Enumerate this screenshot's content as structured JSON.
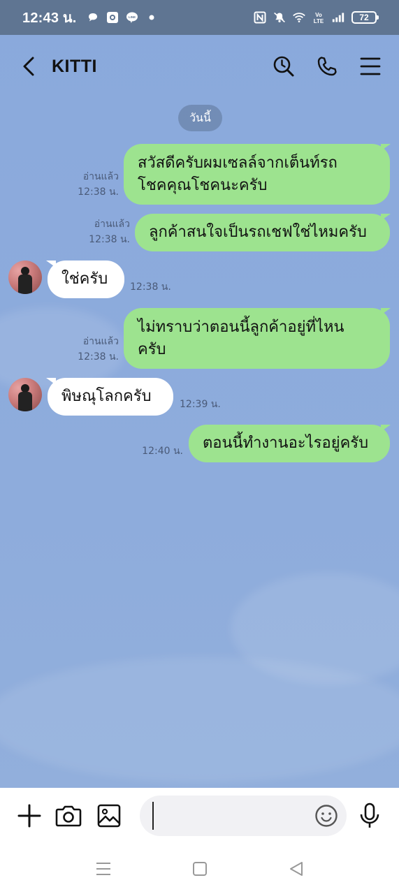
{
  "status_bar": {
    "time": "12:43 น.",
    "battery": "72",
    "left_icons": [
      "chat-bubble-icon",
      "camera-square-icon",
      "line-icon",
      "dot-icon"
    ],
    "right_icons": [
      "nfc-icon",
      "mute-icon",
      "wifi-icon",
      "volte-icon",
      "signal-icon",
      "battery-icon"
    ]
  },
  "header": {
    "title": "KITTI"
  },
  "chat": {
    "date_separator": "วันนี้",
    "messages": [
      {
        "direction": "out",
        "lines": [
          "สวัสดีครับผมเซลล์จากเต็นท์รถ",
          "โชคคุณโชคนะครับ"
        ],
        "read": "อ่านแล้ว",
        "time": "12:38 น."
      },
      {
        "direction": "out",
        "lines": [
          "ลูกค้าสนใจเป็นรถเชฟใช่ไหมครับ"
        ],
        "read": "อ่านแล้ว",
        "time": "12:38 น."
      },
      {
        "direction": "in",
        "lines": [
          "ใช่ครับ"
        ],
        "time": "12:38 น."
      },
      {
        "direction": "out",
        "lines": [
          "ไม่ทราบว่าตอนนี้ลูกค้าอยู่ที่ไหน",
          "ครับ"
        ],
        "read": "อ่านแล้ว",
        "time": "12:38 น."
      },
      {
        "direction": "in",
        "lines": [
          "พิษณุโลกครับ"
        ],
        "time": "12:39 น."
      },
      {
        "direction": "out",
        "lines": [
          "ตอนนี้ทำงานอะไรอยู่ครับ"
        ],
        "time": "12:40 น."
      }
    ]
  },
  "composer": {
    "input_value": "",
    "icons": [
      "plus-icon",
      "camera-icon",
      "image-icon",
      "emoji-icon",
      "microphone-icon"
    ]
  },
  "colors": {
    "background": "#8eaadb",
    "outgoing_bubble": "#9de38f",
    "incoming_bubble": "#ffffff",
    "status_bar": "#5f7592"
  }
}
